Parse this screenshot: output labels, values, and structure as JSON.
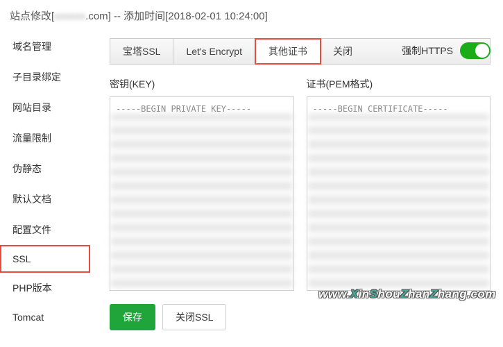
{
  "header": {
    "prefix": "站点修改[",
    "domain_blur": "xxxxxx",
    "suffix": ".com] -- 添加时间[2018-02-01 10:24:00]"
  },
  "sidebar": {
    "items": [
      {
        "label": "域名管理"
      },
      {
        "label": "子目录绑定"
      },
      {
        "label": "网站目录"
      },
      {
        "label": "流量限制"
      },
      {
        "label": "伪静态"
      },
      {
        "label": "默认文档"
      },
      {
        "label": "配置文件"
      },
      {
        "label": "SSL",
        "active": true
      },
      {
        "label": "PHP版本"
      },
      {
        "label": "Tomcat"
      }
    ]
  },
  "tabs": [
    {
      "label": "宝塔SSL"
    },
    {
      "label": "Let's Encrypt"
    },
    {
      "label": "其他证书",
      "active": true
    },
    {
      "label": "关闭"
    }
  ],
  "force_https": {
    "label": "强制HTTPS",
    "enabled": true
  },
  "fields": {
    "key": {
      "label": "密钥(KEY)",
      "value": "-----BEGIN PRIVATE KEY-----\n"
    },
    "cert": {
      "label": "证书(PEM格式)",
      "value": "-----BEGIN CERTIFICATE-----\n"
    }
  },
  "actions": {
    "save": "保存",
    "close_ssl": "关闭SSL"
  },
  "watermark": "www.XinShouZhanZhang.com"
}
